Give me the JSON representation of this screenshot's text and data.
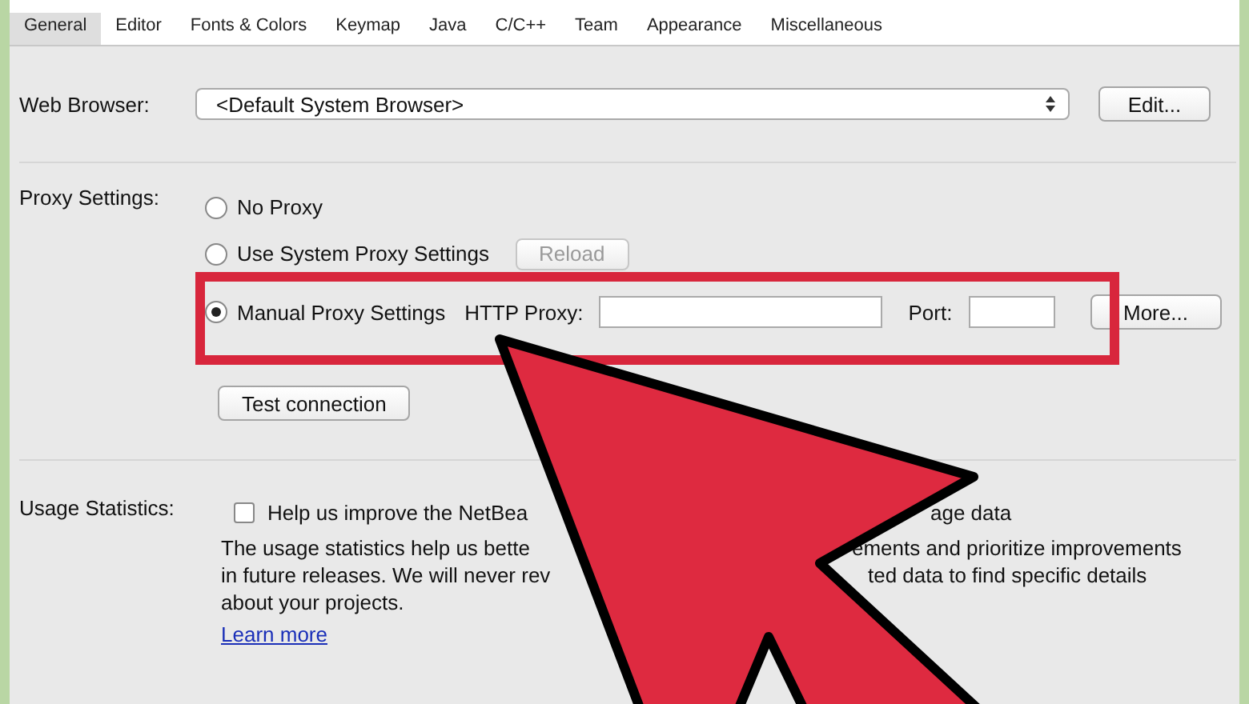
{
  "toolbar": {
    "tabs": [
      {
        "label": "General",
        "selected": true
      },
      {
        "label": "Editor",
        "selected": false
      },
      {
        "label": "Fonts & Colors",
        "selected": false
      },
      {
        "label": "Keymap",
        "selected": false
      },
      {
        "label": "Java",
        "selected": false
      },
      {
        "label": "C/C++",
        "selected": false
      },
      {
        "label": "Team",
        "selected": false
      },
      {
        "label": "Appearance",
        "selected": false
      },
      {
        "label": "Miscellaneous",
        "selected": false
      }
    ]
  },
  "web_browser": {
    "label": "Web Browser:",
    "value": "<Default System Browser>",
    "button": "Edit..."
  },
  "proxy": {
    "label": "Proxy Settings:",
    "options": [
      {
        "label": "No Proxy",
        "selected": false
      },
      {
        "label": "Use System Proxy Settings",
        "selected": false,
        "button": "Reload",
        "button_disabled": true
      },
      {
        "label": "Manual Proxy Settings",
        "selected": true
      }
    ],
    "http_proxy_label": "HTTP Proxy:",
    "port_label": "Port:",
    "more_button": "More...",
    "test_button": "Test connection"
  },
  "usage": {
    "label": "Usage Statistics:",
    "checkbox": {
      "checked": false,
      "label_parts": [
        "Help us improve the NetBea",
        "age data"
      ]
    },
    "description_lines": [
      [
        "The usage statistics help us bette",
        "ements and prioritize improvements"
      ],
      [
        "in future releases. We will never rev",
        "ted data to find specific details"
      ],
      [
        "about your projects."
      ]
    ],
    "link": "Learn more"
  }
}
